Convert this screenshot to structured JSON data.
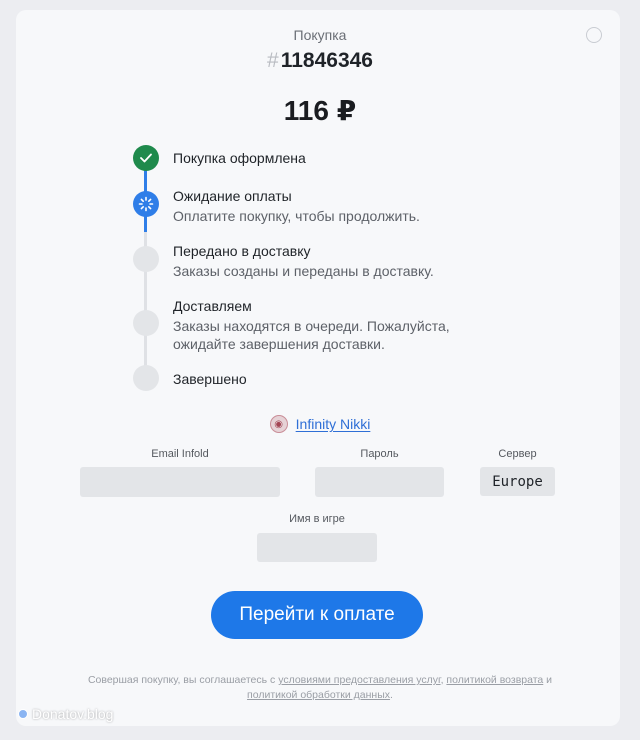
{
  "header": {
    "purchase_label": "Покупка",
    "hash_symbol": "#",
    "order_id": "11846346",
    "price": "116 ₽"
  },
  "steps": [
    {
      "title": "Покупка оформлена",
      "description": "",
      "state": "done"
    },
    {
      "title": "Ожидание оплаты",
      "description": "Оплатите покупку, чтобы продолжить.",
      "state": "current"
    },
    {
      "title": "Передано в доставку",
      "description": "Заказы созданы и переданы в доставку.",
      "state": "pending"
    },
    {
      "title": "Доставляем",
      "description": "Заказы находятся в очереди. Пожалуйста, ожидайте завершения доставки.",
      "state": "pending"
    },
    {
      "title": "Завершено",
      "description": "",
      "state": "pending"
    }
  ],
  "game": {
    "name": "Infinity Nikki",
    "avatar_icon": "game-avatar-icon"
  },
  "form": {
    "email_label": "Email Infold",
    "email_value": "",
    "password_label": "Пароль",
    "password_value": "",
    "server_label": "Сервер",
    "server_value": "Europe",
    "ingame_name_label": "Имя в игре",
    "ingame_name_value": ""
  },
  "pay_button_label": "Перейти к оплате",
  "legal": {
    "part1": "Совершая покупку, вы соглашаетесь с ",
    "terms_link": "условиями предоставления услуг",
    "part2": ", ",
    "refund_link": "политикой возврата",
    "part3": " и ",
    "privacy_link": "политикой обработки данных",
    "part4": "."
  },
  "watermark": "Donatov.blog",
  "colors": {
    "accent": "#1e78e8",
    "done": "#1f8a4c",
    "pending": "#e3e5e8",
    "link": "#2f6fd6"
  }
}
